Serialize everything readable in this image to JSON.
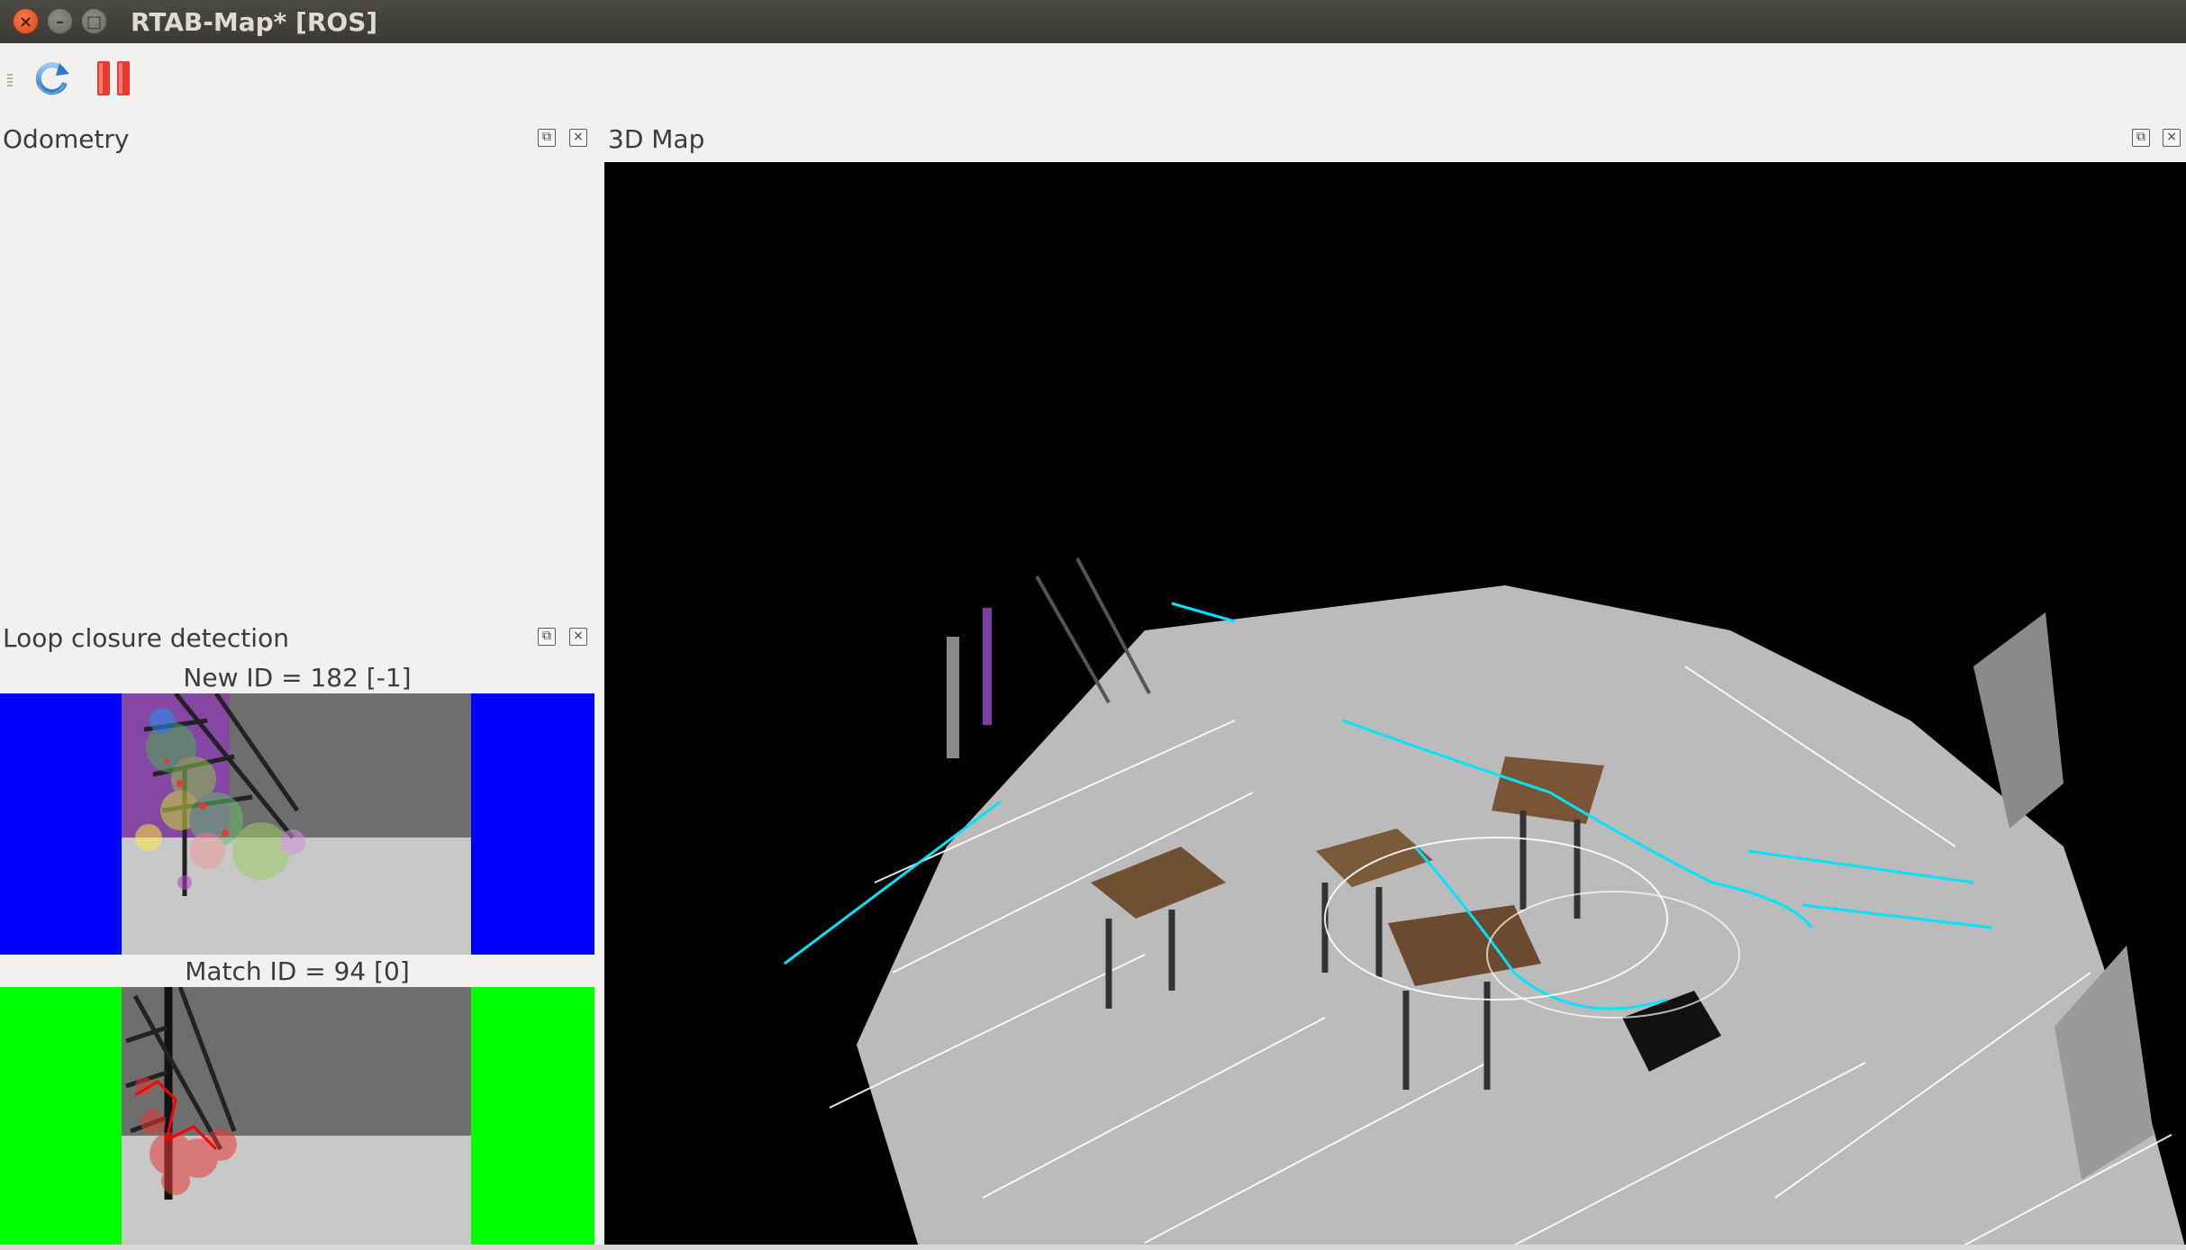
{
  "window": {
    "title": "RTAB-Map* [ROS]",
    "buttons": {
      "close": "×",
      "minimize": "–",
      "maximize": "□"
    }
  },
  "toolbar": {
    "items": [
      {
        "name": "refresh",
        "icon": "refresh-icon"
      },
      {
        "name": "pause",
        "icon": "pause-icon",
        "color": "#e53a2e"
      }
    ]
  },
  "docks": {
    "odometry": {
      "title": "Odometry"
    },
    "loop_closure": {
      "title": "Loop closure detection",
      "new_id_label": "New ID = 182 [-1]",
      "match_id_label": "Match ID = 94 [0]",
      "new_side_color": "#0000ff",
      "match_side_color": "#00ff00"
    },
    "map3d": {
      "title": "3D Map",
      "background": "#000000"
    }
  },
  "dock_buttons": {
    "float": "⧉",
    "close": "×"
  }
}
